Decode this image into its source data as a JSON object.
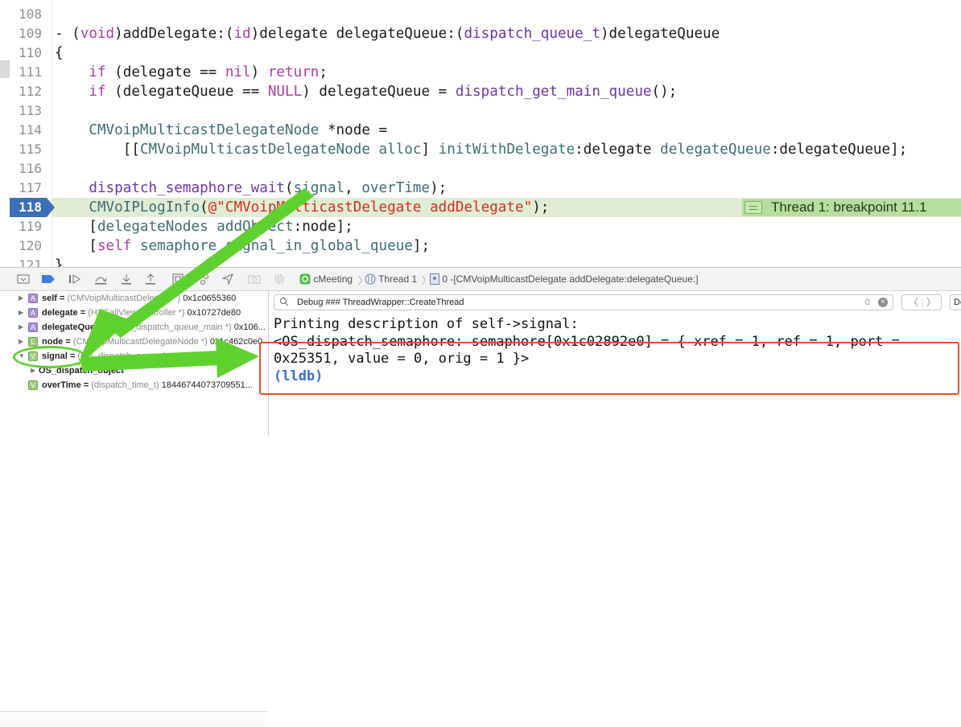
{
  "editor": {
    "lines": [
      {
        "num": "108",
        "code": ""
      },
      {
        "num": "109",
        "code": "- (void)addDelegate:(id)delegate delegateQueue:(dispatch_queue_t)delegateQueue"
      },
      {
        "num": "110",
        "code": "{"
      },
      {
        "num": "111",
        "code": "    if (delegate == nil) return;"
      },
      {
        "num": "112",
        "code": "    if (delegateQueue == NULL) delegateQueue = dispatch_get_main_queue();"
      },
      {
        "num": "113",
        "code": ""
      },
      {
        "num": "114",
        "code": "    CMVoipMulticastDelegateNode *node ="
      },
      {
        "num": "115",
        "code": "        [[CMVoipMulticastDelegateNode alloc] initWithDelegate:delegate delegateQueue:delegateQueue];"
      },
      {
        "num": "116",
        "code": ""
      },
      {
        "num": "117",
        "code": "    dispatch_semaphore_wait(signal, overTime);"
      },
      {
        "num": "118",
        "code": "    CMVoIPLogInfo(@\"CMVoipMulticastDelegate addDelegate\");"
      },
      {
        "num": "119",
        "code": "    [delegateNodes addObject:node];"
      },
      {
        "num": "120",
        "code": "    [self semaphore_signal_in_global_queue];"
      },
      {
        "num": "121",
        "code": "}"
      }
    ],
    "current_line": "118",
    "breakpoint_label": "Thread 1: breakpoint 11.1"
  },
  "debug_bar": {
    "app": "cMeeting",
    "thread": "Thread 1",
    "frame": "0 -[CMVoipMulticastDelegate addDelegate:delegateQueue:]"
  },
  "variables": [
    {
      "badge": "A",
      "name": "self",
      "type": "(CMVoipMulticastDelegate *)",
      "value": "0x1c0655360",
      "expanded": false
    },
    {
      "badge": "A",
      "name": "delegate",
      "type": "(HYCallViewController *)",
      "value": "0x10727de80",
      "expanded": false
    },
    {
      "badge": "A",
      "name": "delegateQueue",
      "type": "(OS_dispatch_queue_main *)",
      "value": "0x106...",
      "expanded": false
    },
    {
      "badge": "L",
      "name": "node",
      "type": "(CMVoipMulticastDelegateNode *)",
      "value": "0x1c462c0e0",
      "expanded": false
    },
    {
      "badge": "V",
      "name": "signal",
      "type": "(OS_dispatch_semaphore *)",
      "value": "0x1c02892e0",
      "expanded": true
    },
    {
      "badge": "",
      "name": "OS_dispatch_object",
      "type": "",
      "value": "",
      "expanded": false
    },
    {
      "badge": "V",
      "name": "overTime",
      "type": "(dispatch_time_t)",
      "value": "18446744073709551...",
      "expanded": false
    }
  ],
  "console": {
    "search_text": "Debug ### ThreadWrapper::CreateThread",
    "search_count": "0",
    "lines": [
      "Printing description of self->signal:",
      "<OS_dispatch_semaphore: semaphore[0x1c02892e0] = { xref = 1, ref = 1, port =",
      "0x25351, value = 0, orig = 1 }>",
      "(lldb)"
    ]
  },
  "colors": {
    "highlight": "#e1ecd5",
    "marker": "#3b6fb6",
    "annotation_green": "#5fd12e",
    "annotation_red": "#e3522c"
  }
}
